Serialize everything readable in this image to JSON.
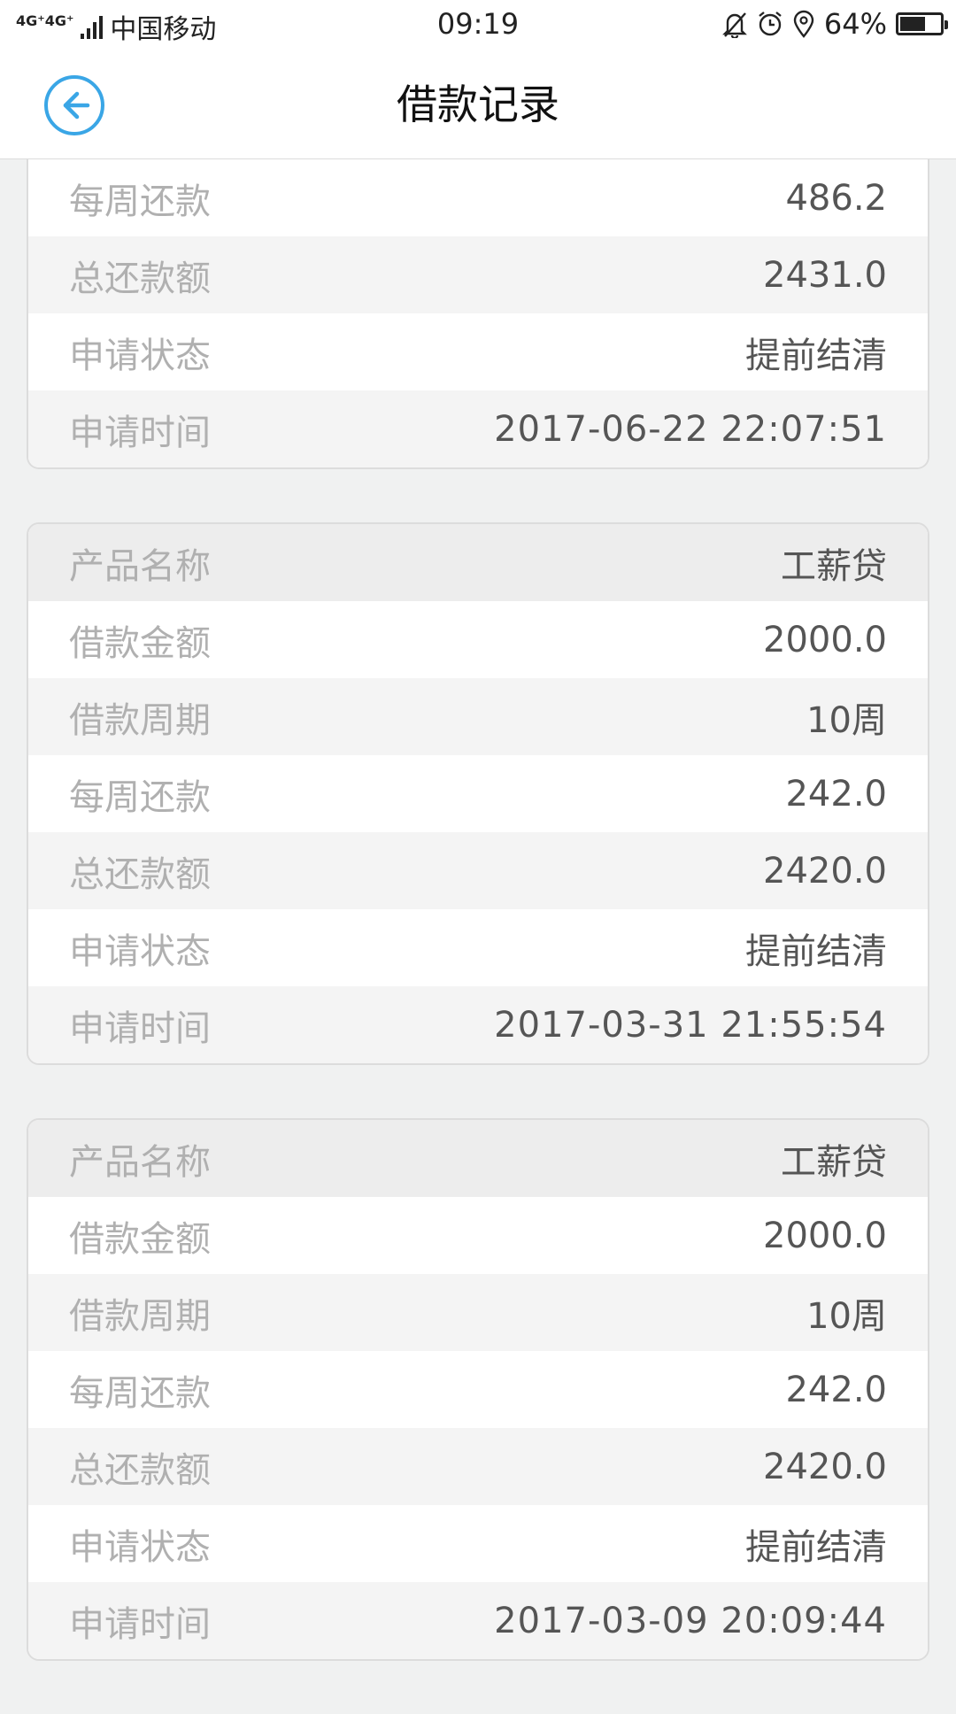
{
  "status_bar": {
    "network": "4G⁺4G⁺",
    "carrier": "中国移动",
    "time": "09:19",
    "battery": "64%",
    "battery_level": 0.64,
    "icons": [
      "mute-bell-icon",
      "alarm-icon",
      "location-icon",
      "battery-icon"
    ]
  },
  "header": {
    "title": "借款记录",
    "back_icon": "back-arrow-icon",
    "accent_color": "#3aa6e6"
  },
  "records": [
    {
      "partial": true,
      "rows": [
        {
          "label": "每周还款",
          "value": "486.2"
        },
        {
          "label": "总还款额",
          "value": "2431.0"
        },
        {
          "label": "申请状态",
          "value": "提前结清"
        },
        {
          "label": "申请时间",
          "value": "2017-06-22 22:07:51"
        }
      ]
    },
    {
      "partial": false,
      "rows": [
        {
          "label": "产品名称",
          "value": "工薪贷"
        },
        {
          "label": "借款金额",
          "value": "2000.0"
        },
        {
          "label": "借款周期",
          "value": "10周"
        },
        {
          "label": "每周还款",
          "value": "242.0"
        },
        {
          "label": "总还款额",
          "value": "2420.0"
        },
        {
          "label": "申请状态",
          "value": "提前结清"
        },
        {
          "label": "申请时间",
          "value": "2017-03-31 21:55:54"
        }
      ]
    },
    {
      "partial": false,
      "rows": [
        {
          "label": "产品名称",
          "value": "工薪贷"
        },
        {
          "label": "借款金额",
          "value": "2000.0"
        },
        {
          "label": "借款周期",
          "value": "10周"
        },
        {
          "label": "每周还款",
          "value": "242.0"
        },
        {
          "label": "总还款额",
          "value": "2420.0"
        },
        {
          "label": "申请状态",
          "value": "提前结清"
        },
        {
          "label": "申请时间",
          "value": "2017-03-09 20:09:44"
        }
      ]
    }
  ]
}
